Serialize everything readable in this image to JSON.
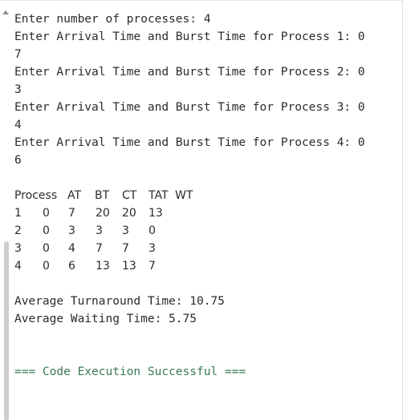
{
  "input_lines": [
    "Enter number of processes: 4",
    "Enter Arrival Time and Burst Time for Process 1: 0",
    "7",
    "Enter Arrival Time and Burst Time for Process 2: 0",
    "3",
    "Enter Arrival Time and Burst Time for Process 3: 0",
    "4",
    "Enter Arrival Time and Burst Time for Process 4: 0",
    "6"
  ],
  "table": {
    "headers": [
      "Process",
      "AT",
      "BT",
      "CT",
      "TAT",
      "WT"
    ],
    "rows": [
      [
        "1",
        "0",
        "7",
        "20",
        "20",
        "13"
      ],
      [
        "2",
        "0",
        "3",
        "3",
        "3",
        "0"
      ],
      [
        "3",
        "0",
        "4",
        "7",
        "7",
        "3"
      ],
      [
        "4",
        "0",
        "6",
        "13",
        "13",
        "7"
      ]
    ]
  },
  "averages": {
    "turnaround": "Average Turnaround Time: 10.75",
    "waiting": "Average Waiting Time: 5.75"
  },
  "status_message": "=== Code Execution Successful ===",
  "colors": {
    "text": "#2b2b2b",
    "success": "#3a7a52",
    "background": "#ffffff"
  }
}
